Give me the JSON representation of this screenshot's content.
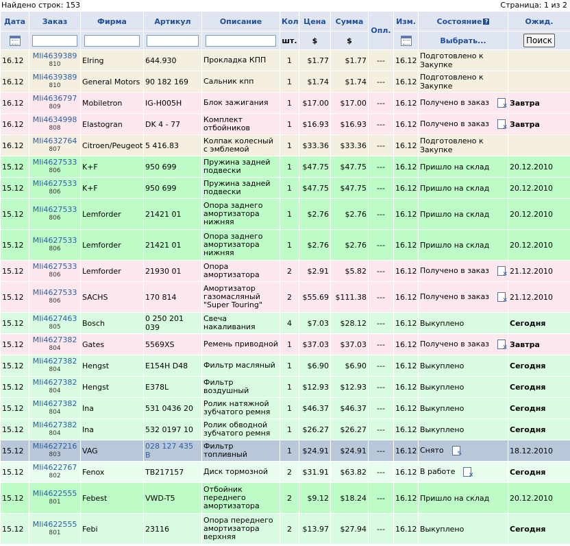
{
  "topbar": {
    "found": "Найдено строк: 153",
    "page": "Страница: 1 из 2"
  },
  "headers": {
    "date": "Дата",
    "order": "Заказ",
    "brand": "Фирма",
    "article": "Артикул",
    "description": "Описание",
    "qty": "Кол",
    "qty_unit": "шт.",
    "price": "Цена",
    "price_unit": "$",
    "sum": "Сумма",
    "sum_unit": "$",
    "paid": "Опл.",
    "changed": "Изм.",
    "state": "Состояние",
    "state_select": "Выбрать...",
    "expected": "Ожид.",
    "search_button": "Поиск"
  },
  "colors": {
    "beige": "#f4efdf",
    "pink": "#fde8ee",
    "green": "#bdfcc6",
    "lightgreen": "#d9fbe1",
    "gray": "#b9c8d9",
    "mint": "#e8fdee"
  },
  "rows": [
    {
      "date": "16.12",
      "order": "MIi4639389",
      "sub": "810",
      "brand": "Elring",
      "article": "644.930",
      "desc": "Прокладка КПП",
      "qty": "1",
      "price": "$1.77",
      "sum": "$1.77",
      "paid": "---",
      "changed": "16.12",
      "state": "Подготовлено к Закупке",
      "icon": "",
      "expected": "",
      "exp_bold": false,
      "bg": "#f4efdf",
      "h": 31
    },
    {
      "date": "16.12",
      "order": "MIi4639389",
      "sub": "810",
      "brand": "General Motors",
      "article": "90 182 169",
      "desc": "Сальник кпп",
      "qty": "1",
      "price": "$1.74",
      "sum": "$1.74",
      "paid": "---",
      "changed": "16.12",
      "state": "Подготовлено к Закупке",
      "icon": "",
      "expected": "",
      "exp_bold": false,
      "bg": "#f4efdf",
      "h": 31
    },
    {
      "date": "16.12",
      "order": "MIi4636797",
      "sub": "809",
      "brand": "Mobiletron",
      "article": "IG-H005H",
      "desc": "Блок зажигания",
      "qty": "1",
      "price": "$17.00",
      "sum": "$17.00",
      "paid": "---",
      "changed": "16.12",
      "state": "Получено в заказ",
      "icon": "x",
      "expected": "Завтра",
      "exp_bold": true,
      "bg": "#fde8ee",
      "h": 31
    },
    {
      "date": "16.12",
      "order": "MIi4634998",
      "sub": "808",
      "brand": "Elastogran",
      "article": "DK 4 - 77",
      "desc": "Комплект отбойников",
      "qty": "1",
      "price": "$16.93",
      "sum": "$16.93",
      "paid": "---",
      "changed": "16.12",
      "state": "Получено в заказ",
      "icon": "x",
      "expected": "Завтра",
      "exp_bold": true,
      "bg": "#fde8ee",
      "h": 31
    },
    {
      "date": "16.12",
      "order": "MIi4632764",
      "sub": "807",
      "brand": "Citroen/Peugeot",
      "article": "5 416.83",
      "desc": "Колпак колесный с эмблемой",
      "qty": "1",
      "price": "$33.36",
      "sum": "$33.36",
      "paid": "---",
      "changed": "16.12",
      "state": "Подготовлено к Закупке",
      "icon": "",
      "expected": "",
      "exp_bold": false,
      "bg": "#f4efdf",
      "h": 31
    },
    {
      "date": "15.12",
      "order": "MIi4627533",
      "sub": "806",
      "brand": "K+F",
      "article": "950 699",
      "desc": "Пружина задней подвески",
      "qty": "1",
      "price": "$47.75",
      "sum": "$47.75",
      "paid": "---",
      "changed": "16.12",
      "state": "Пришло на склад",
      "icon": "",
      "expected": "20.12.2010",
      "exp_bold": false,
      "bg": "#bdfcc6",
      "h": 31
    },
    {
      "date": "15.12",
      "order": "MIi4627533",
      "sub": "806",
      "brand": "K+F",
      "article": "950 699",
      "desc": "Пружина задней подвески",
      "qty": "1",
      "price": "$47.75",
      "sum": "$47.75",
      "paid": "---",
      "changed": "16.12",
      "state": "Пришло на склад",
      "icon": "",
      "expected": "20.12.2010",
      "exp_bold": false,
      "bg": "#bdfcc6",
      "h": 31
    },
    {
      "date": "15.12",
      "order": "MIi4627533",
      "sub": "806",
      "brand": "Lemforder",
      "article": "21421 01",
      "desc": "Опора заднего амортизатора нижняя",
      "qty": "1",
      "price": "$2.76",
      "sum": "$2.76",
      "paid": "---",
      "changed": "16.12",
      "state": "Пришло на склад",
      "icon": "",
      "expected": "20.12.2010",
      "exp_bold": false,
      "bg": "#bdfcc6",
      "h": 45
    },
    {
      "date": "15.12",
      "order": "MIi4627533",
      "sub": "806",
      "brand": "Lemforder",
      "article": "21421 01",
      "desc": "Опора заднего амортизатора нижняя",
      "qty": "1",
      "price": "$2.76",
      "sum": "$2.76",
      "paid": "---",
      "changed": "16.12",
      "state": "Пришло на склад",
      "icon": "",
      "expected": "20.12.2010",
      "exp_bold": false,
      "bg": "#bdfcc6",
      "h": 45
    },
    {
      "date": "15.12",
      "order": "MIi4627533",
      "sub": "806",
      "brand": "Lemforder",
      "article": "21930 01",
      "desc": "Опора амортизатора",
      "qty": "2",
      "price": "$2.91",
      "sum": "$5.82",
      "paid": "---",
      "changed": "16.12",
      "state": "Получено в заказ",
      "icon": "x",
      "expected": "21.12.2010",
      "exp_bold": false,
      "bg": "#fde8ee",
      "h": 31
    },
    {
      "date": "15.12",
      "order": "MIi4627533",
      "sub": "806",
      "brand": "SACHS",
      "article": "170 814",
      "desc": "Амортизатор газомасляный \"Super Touring\"",
      "qty": "2",
      "price": "$55.69",
      "sum": "$111.38",
      "paid": "---",
      "changed": "16.12",
      "state": "Получено в заказ",
      "icon": "x",
      "expected": "21.12.2010",
      "exp_bold": false,
      "bg": "#fde8ee",
      "h": 45
    },
    {
      "date": "15.12",
      "order": "MIi4627463",
      "sub": "805",
      "brand": "Bosch",
      "article": "0 250 201 039",
      "desc": "Свеча накаливания",
      "qty": "4",
      "price": "$7.03",
      "sum": "$28.12",
      "paid": "---",
      "changed": "16.12",
      "state": "Выкуплено",
      "icon": "",
      "expected": "Сегодня",
      "exp_bold": true,
      "bg": "#d9fbe1",
      "h": 31
    },
    {
      "date": "15.12",
      "order": "MIi4627382",
      "sub": "804",
      "brand": "Gates",
      "article": "5569XS",
      "desc": "Ремень приводной",
      "qty": "1",
      "price": "$37.03",
      "sum": "$37.03",
      "paid": "---",
      "changed": "16.12",
      "state": "Получено в заказ",
      "icon": "x",
      "expected": "Завтра",
      "exp_bold": true,
      "bg": "#fde8ee",
      "h": 31
    },
    {
      "date": "15.12",
      "order": "MIi4627382",
      "sub": "804",
      "brand": "Hengst",
      "article": "E154H D48",
      "desc": "Фильтр масляный",
      "qty": "1",
      "price": "$6.90",
      "sum": "$6.90",
      "paid": "---",
      "changed": "16.12",
      "state": "Выкуплено",
      "icon": "",
      "expected": "Сегодня",
      "exp_bold": true,
      "bg": "#d9fbe1",
      "h": 31
    },
    {
      "date": "15.12",
      "order": "MIi4627382",
      "sub": "804",
      "brand": "Hengst",
      "article": "E378L",
      "desc": "Фильтр воздушный",
      "qty": "1",
      "price": "$12.93",
      "sum": "$12.93",
      "paid": "---",
      "changed": "16.12",
      "state": "Выкуплено",
      "icon": "",
      "expected": "Сегодня",
      "exp_bold": true,
      "bg": "#d9fbe1",
      "h": 31
    },
    {
      "date": "15.12",
      "order": "MIi4627382",
      "sub": "804",
      "brand": "Ina",
      "article": "531 0436 20",
      "desc": "Ролик натяжной зубчатого ремня",
      "qty": "1",
      "price": "$46.37",
      "sum": "$46.37",
      "paid": "---",
      "changed": "16.12",
      "state": "Выкуплено",
      "icon": "",
      "expected": "Сегодня",
      "exp_bold": true,
      "bg": "#d9fbe1",
      "h": 31
    },
    {
      "date": "15.12",
      "order": "MIi4627382",
      "sub": "804",
      "brand": "Ina",
      "article": "532 0197 10",
      "desc": "Ролик обводной зубчатого ремня",
      "qty": "1",
      "price": "$26.27",
      "sum": "$26.27",
      "paid": "---",
      "changed": "16.12",
      "state": "Выкуплено",
      "icon": "",
      "expected": "Сегодня",
      "exp_bold": true,
      "bg": "#d9fbe1",
      "h": 31
    },
    {
      "date": "15.12",
      "order": "MIi4627216",
      "sub": "803",
      "brand": "VAG",
      "article": "028 127 435 B",
      "desc": "Фильтр топливный",
      "qty": "1",
      "price": "$24.91",
      "sum": "$24.91",
      "paid": "---",
      "changed": "16.12",
      "state": "Снято",
      "icon": "pen",
      "expected": "18.12.2010",
      "exp_bold": false,
      "bg": "#b9c8d9",
      "h": 31,
      "article_link": true
    },
    {
      "date": "15.12",
      "order": "MIi4622767",
      "sub": "802",
      "brand": "Fenox",
      "article": "TB217157",
      "desc": "Диск тормозной",
      "qty": "2",
      "price": "$31.91",
      "sum": "$63.82",
      "paid": "---",
      "changed": "16.12",
      "state": "В работе",
      "icon": "x",
      "expected": "Сегодня",
      "exp_bold": true,
      "bg": "#e8fdee",
      "h": 31
    },
    {
      "date": "15.12",
      "order": "MIi4622555",
      "sub": "801",
      "brand": "Febest",
      "article": "VWD-T5",
      "desc": "Отбойник переднего амортизатора",
      "qty": "2",
      "price": "$9.12",
      "sum": "$18.24",
      "paid": "---",
      "changed": "16.12",
      "state": "Пришло на склад",
      "icon": "",
      "expected": "20.12.2010",
      "exp_bold": false,
      "bg": "#bdfcc6",
      "h": 45
    },
    {
      "date": "15.12",
      "order": "MIi4622555",
      "sub": "801",
      "brand": "Febi",
      "article": "23116",
      "desc": "Опора переднего амортизатора верхняя",
      "qty": "2",
      "price": "$13.97",
      "sum": "$27.94",
      "paid": "---",
      "changed": "16.12",
      "state": "Выкуплено",
      "icon": "",
      "expected": "Сегодня",
      "exp_bold": true,
      "bg": "#d9fbe1",
      "h": 45
    }
  ]
}
